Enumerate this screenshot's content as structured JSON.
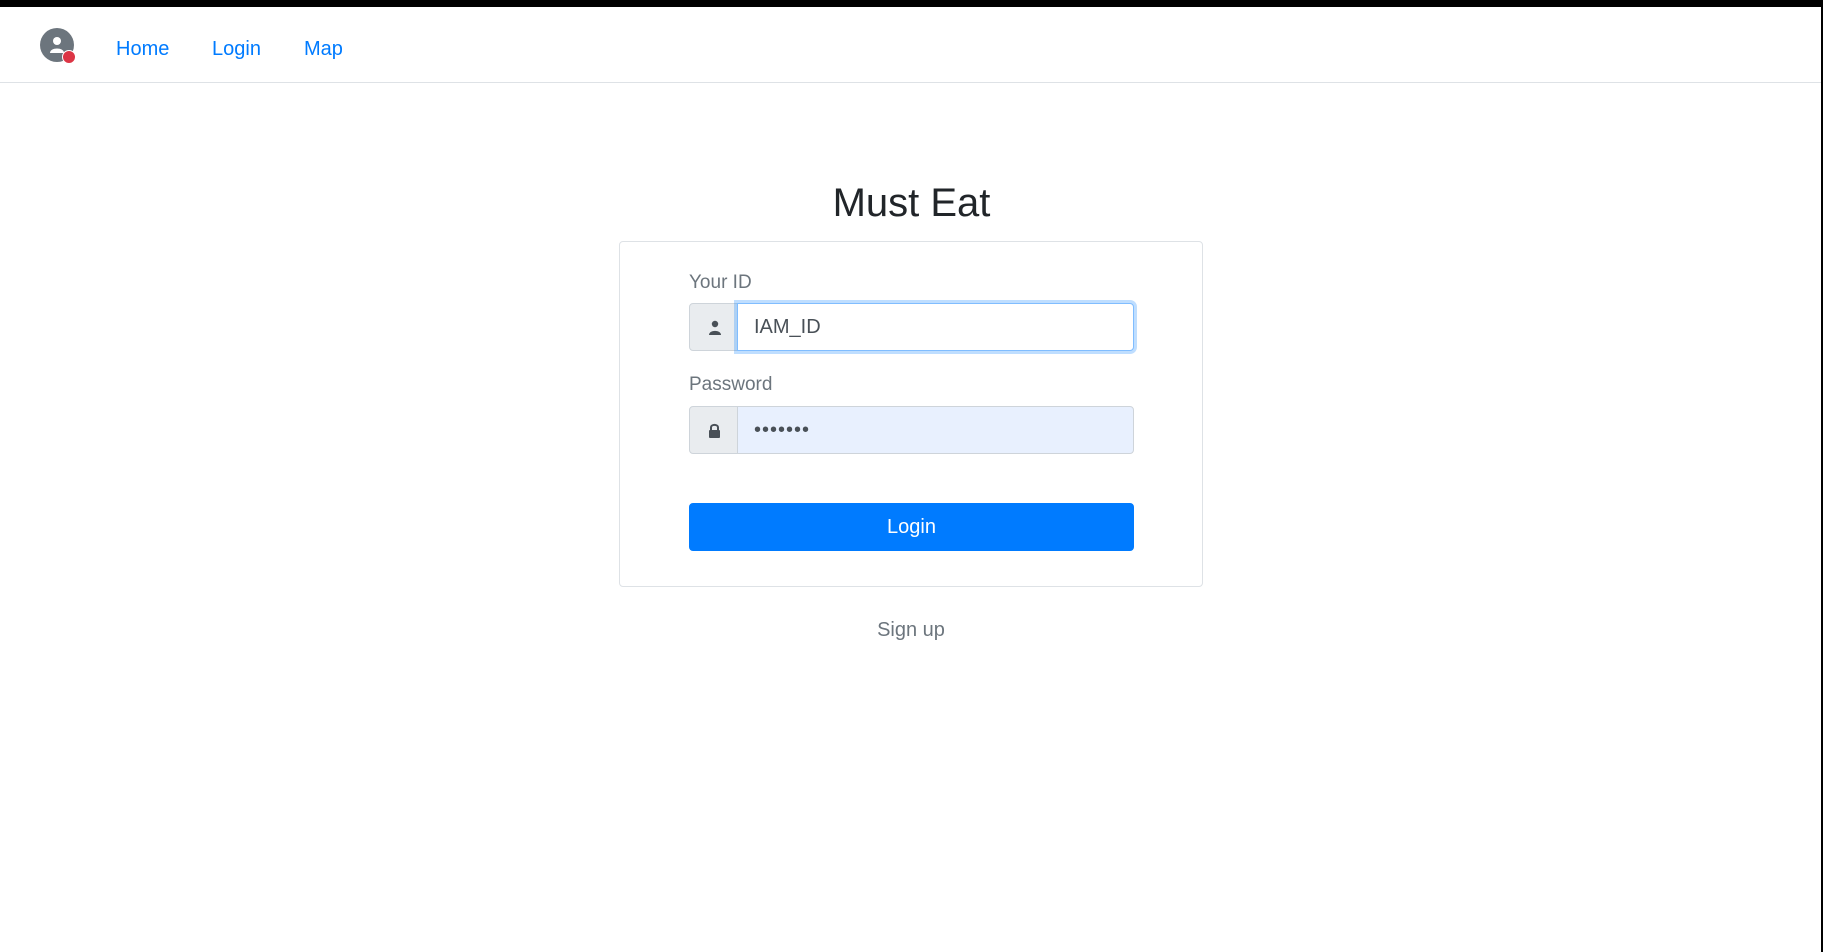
{
  "navbar": {
    "avatar_icon": "user-circle-icon",
    "notification_color": "#dc3545",
    "links": [
      {
        "label": "Home"
      },
      {
        "label": "Login"
      },
      {
        "label": "Map"
      }
    ]
  },
  "main": {
    "title": "Must Eat",
    "form": {
      "id_label": "Your ID",
      "id_value": "IAM_ID",
      "id_icon": "user-icon",
      "password_label": "Password",
      "password_value": "•••••••",
      "password_icon": "lock-icon",
      "submit_label": "Login"
    },
    "signup_label": "Sign up"
  },
  "colors": {
    "primary": "#007bff",
    "muted_text": "#6c757d",
    "heading_text": "#212529",
    "input_addon_bg": "#e9ecef",
    "autofill_bg": "#e8f0fe"
  }
}
